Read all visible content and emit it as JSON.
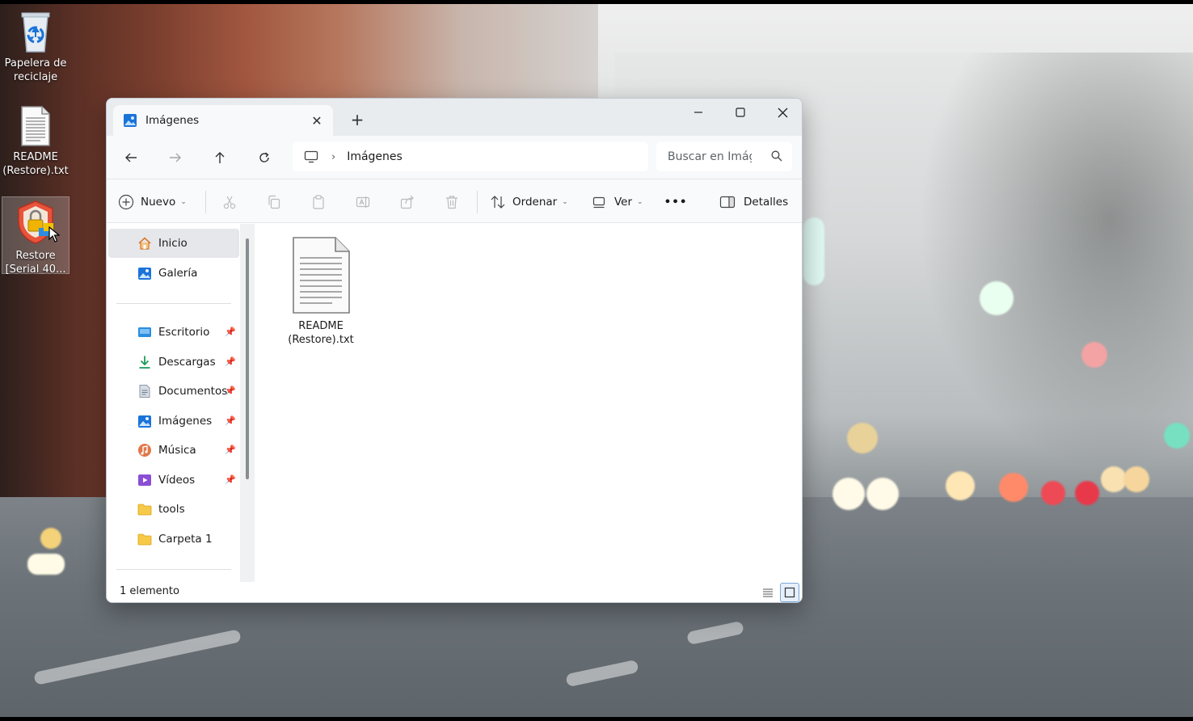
{
  "desktop": {
    "icons": [
      {
        "label_line1": "Papelera de",
        "label_line2": "reciclaje",
        "icon": "recycle-bin-icon"
      },
      {
        "label_line1": "README",
        "label_line2": "(Restore).txt",
        "icon": "text-file-icon"
      },
      {
        "label_line1": "Restore",
        "label_line2": "[Serial 40...",
        "icon": "restore-shield-icon"
      }
    ]
  },
  "window": {
    "tab_title": "Imágenes",
    "close_tab_symbol": "✕",
    "new_tab_symbol": "+",
    "controls": {
      "minimize": "—",
      "maximize": "☐",
      "close": "✕"
    },
    "address": {
      "path": "Imágenes",
      "separator": "›",
      "search_placeholder": "Buscar en Imágenes"
    },
    "toolbar": {
      "new_label": "Nuevo",
      "sort_label": "Ordenar",
      "view_label": "Ver",
      "more_label": "•••",
      "details_label": "Detalles"
    },
    "sidebar": {
      "items": [
        {
          "label": "Inicio",
          "icon": "home-icon"
        },
        {
          "label": "Galería",
          "icon": "gallery-icon"
        },
        {
          "label": "Escritorio",
          "icon": "desktop-folder-icon",
          "pinned": true
        },
        {
          "label": "Descargas",
          "icon": "download-icon",
          "pinned": true
        },
        {
          "label": "Documentos",
          "icon": "documents-icon",
          "pinned": true
        },
        {
          "label": "Imágenes",
          "icon": "pictures-icon",
          "pinned": true
        },
        {
          "label": "Música",
          "icon": "music-icon",
          "pinned": true
        },
        {
          "label": "Vídeos",
          "icon": "videos-icon",
          "pinned": true
        },
        {
          "label": "tools",
          "icon": "folder-icon"
        },
        {
          "label": "Carpeta 1",
          "icon": "folder-icon"
        }
      ]
    },
    "files": [
      {
        "line1": "README",
        "line2": "(Restore).txt",
        "icon": "text-file-icon"
      }
    ],
    "status": {
      "count_text": "1 elemento"
    }
  }
}
